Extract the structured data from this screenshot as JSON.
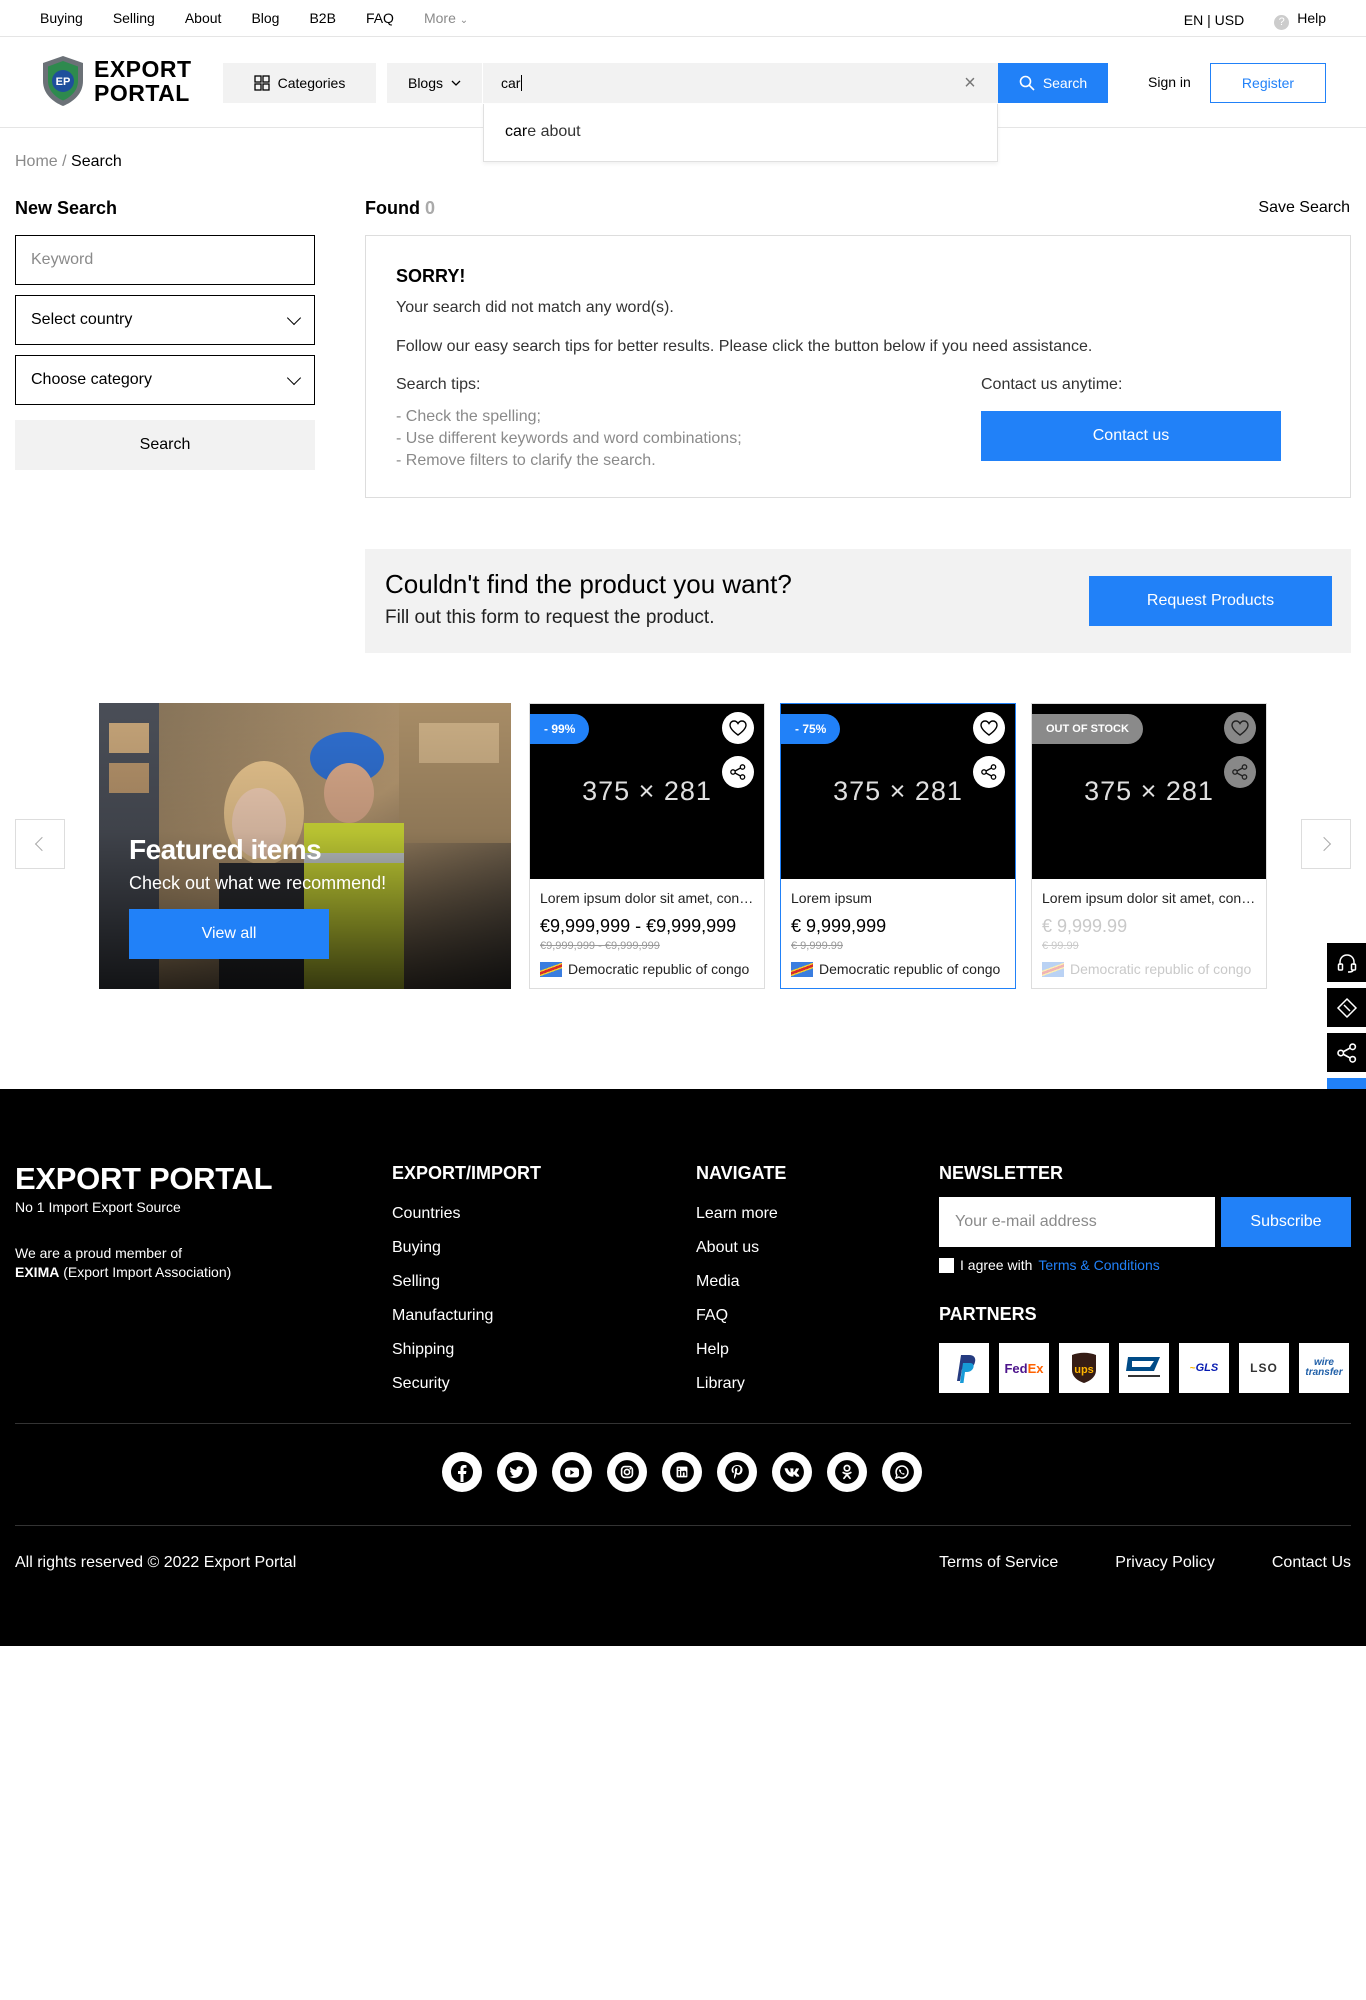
{
  "topbar": {
    "nav": [
      "Buying",
      "Selling",
      "About",
      "Blog",
      "B2B",
      "FAQ"
    ],
    "more": "More",
    "lang": "EN | USD",
    "help": "Help"
  },
  "header": {
    "logo_line1": "EXPORT",
    "logo_line2": "PORTAL",
    "categories": "Categories",
    "blogs": "Blogs",
    "search_value": "car",
    "search_button": "Search",
    "signin": "Sign in",
    "register": "Register",
    "suggestion_match": "car",
    "suggestion_rest": "e about"
  },
  "breadcrumb": {
    "home": "Home",
    "sep": " / ",
    "current": "Search"
  },
  "left": {
    "heading": "New Search",
    "keyword_placeholder": "Keyword",
    "country": "Select country",
    "category": "Choose category",
    "search": "Search"
  },
  "results": {
    "found_label": "Found",
    "found_count": "0",
    "save_search": "Save Search",
    "sorry_title": "SORRY!",
    "sorry_line1": "Your search did not match any word(s).",
    "sorry_line2": "Follow our easy search tips for better results. Please click the button below if you need assistance.",
    "tips_heading": "Search tips:",
    "tips": [
      "- Check the spelling;",
      "- Use different keywords and word combinations;",
      "- Remove filters to clarify the search."
    ],
    "contact_heading": "Contact us anytime:",
    "contact_button": "Contact us"
  },
  "request": {
    "title": "Couldn't find the product you want?",
    "subtitle": "Fill out this form to request the product.",
    "button": "Request Products"
  },
  "featured": {
    "title": "Featured items",
    "subtitle": "Check out what we recommend!",
    "button": "View all"
  },
  "products": [
    {
      "badge": "- 99%",
      "image_text": "375 × 281",
      "title": "Lorem ipsum dolor sit amet, consectetur",
      "price": "€9,999,999 - €9,999,999",
      "old_price": "€9,999,999 - €9,999,999",
      "country": "Democratic republic of congo"
    },
    {
      "badge": "- 75%",
      "image_text": "375 × 281",
      "title": "Lorem ipsum",
      "price": "€ 9,999,999",
      "old_price": "€ 9,999.99",
      "country": "Democratic republic of congo"
    },
    {
      "badge": "OUT OF STOCK",
      "image_text": "375 × 281",
      "title": "Lorem ipsum dolor sit amet, consectetur",
      "price": "€ 9,999.99",
      "old_price": "€ 99.99",
      "country": "Democratic republic of congo"
    }
  ],
  "footer": {
    "brand": "EXPORT PORTAL",
    "tagline": "No 1 Import Export Source",
    "member_line1": "We are a proud member of",
    "member_bold": "EXIMA",
    "member_rest": " (Export Import Association)",
    "col1_heading": "EXPORT/IMPORT",
    "col1_links": [
      "Countries",
      "Buying",
      "Selling",
      "Manufacturing",
      "Shipping",
      "Security"
    ],
    "col2_heading": "NAVIGATE",
    "col2_links": [
      "Learn more",
      "About us",
      "Media",
      "FAQ",
      "Help",
      "Library"
    ],
    "newsletter_heading": "NEWSLETTER",
    "email_placeholder": "Your e-mail address",
    "subscribe": "Subscribe",
    "agree_text": "I agree with ",
    "terms_link": "Terms & Conditions",
    "partners_heading": "PARTNERS",
    "partners": [
      "PayPal",
      "FedEx",
      "ups",
      "USPS",
      "GLS",
      "LSO",
      "wire transfer"
    ],
    "socials": [
      "facebook",
      "twitter",
      "youtube",
      "instagram",
      "linkedin",
      "pinterest",
      "vk",
      "odnoklassniki",
      "whatsapp"
    ],
    "copyright": "All rights reserved © 2022 Export Portal",
    "bottom_links": [
      "Terms of Service",
      "Privacy Policy",
      "Contact Us"
    ]
  },
  "colors": {
    "accent": "#2181f8",
    "footer_bg": "#000000",
    "panel_bg": "#f2f2f2"
  }
}
